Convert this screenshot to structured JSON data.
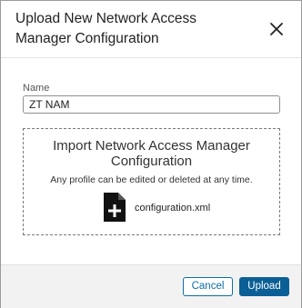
{
  "dialog": {
    "title": "Upload New Network Access Manager Configuration",
    "close_icon": "close-icon"
  },
  "form": {
    "name_label": "Name",
    "name_value": "ZT NAM"
  },
  "dropzone": {
    "title": "Import Network Access Manager Configuration",
    "subtitle": "Any profile can be edited or deleted at any time.",
    "file_icon": "file-add-icon",
    "file_name": "configuration.xml"
  },
  "footer": {
    "cancel_label": "Cancel",
    "upload_label": "Upload"
  },
  "colors": {
    "primary": "#0a5f96",
    "secondary_border": "#0d6fa7",
    "footer_bg": "#f2f2f2"
  }
}
